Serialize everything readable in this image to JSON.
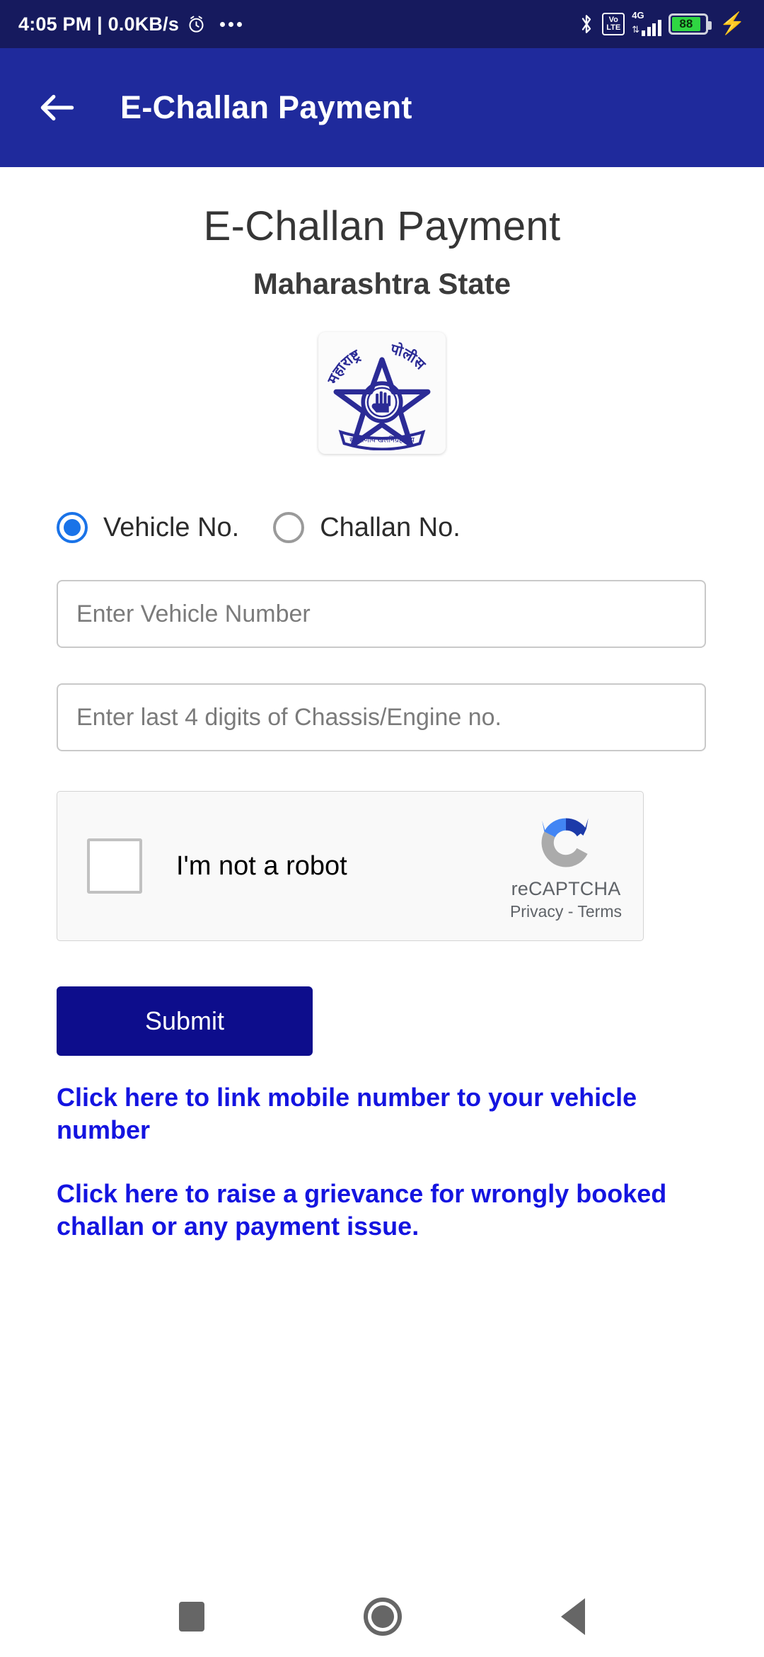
{
  "status_bar": {
    "time_text": "4:05 PM | 0.0KB/s",
    "alarm_icon": "alarm-icon",
    "overflow_icon": "more-dots-icon",
    "bluetooth_icon": "bluetooth-icon",
    "volte_top": "Vo",
    "volte_bottom": "LTE",
    "network_type": "4G",
    "signal_icon": "signal-bars-icon",
    "battery_percent": "88",
    "charging_icon": "charging-bolt-icon"
  },
  "app_bar": {
    "back_icon": "back-arrow-icon",
    "title": "E-Challan Payment"
  },
  "page": {
    "title": "E-Challan Payment",
    "subtitle": "Maharashtra State",
    "logo_name": "maharashtra-police-logo",
    "logo_text_left": "महाराष्ट्र",
    "logo_text_right": "पोलीस",
    "logo_banner_text": "सद्रक्षणाय खलनिग्रहणाय"
  },
  "form": {
    "radio_options": [
      {
        "label": "Vehicle No.",
        "selected": true
      },
      {
        "label": "Challan No.",
        "selected": false
      }
    ],
    "vehicle_input": {
      "value": "",
      "placeholder": "Enter Vehicle Number"
    },
    "chassis_input": {
      "value": "",
      "placeholder": "Enter last 4 digits of Chassis/Engine no."
    },
    "submit_label": "Submit"
  },
  "recaptcha": {
    "checkbox_label": "I'm not a robot",
    "checked": false,
    "brand_name": "reCAPTCHA",
    "terms_text": "Privacy - Terms",
    "logo_name": "recaptcha-logo"
  },
  "links": [
    {
      "text": "Click here to link mobile number to your vehicle number"
    },
    {
      "text": "Click here to raise a grievance for wrongly booked challan or any payment issue."
    }
  ],
  "nav_bar": {
    "recents_label": "recents-square-icon",
    "home_label": "home-circle-icon",
    "back_label": "back-triangle-icon"
  },
  "colors": {
    "status_bar_bg": "#161a5e",
    "app_bar_bg": "#1f2a9c",
    "submit_bg": "#0d0d8c",
    "link_color": "#1414e0",
    "radio_selected": "#1a73e8",
    "battery_green": "#2fd642"
  }
}
